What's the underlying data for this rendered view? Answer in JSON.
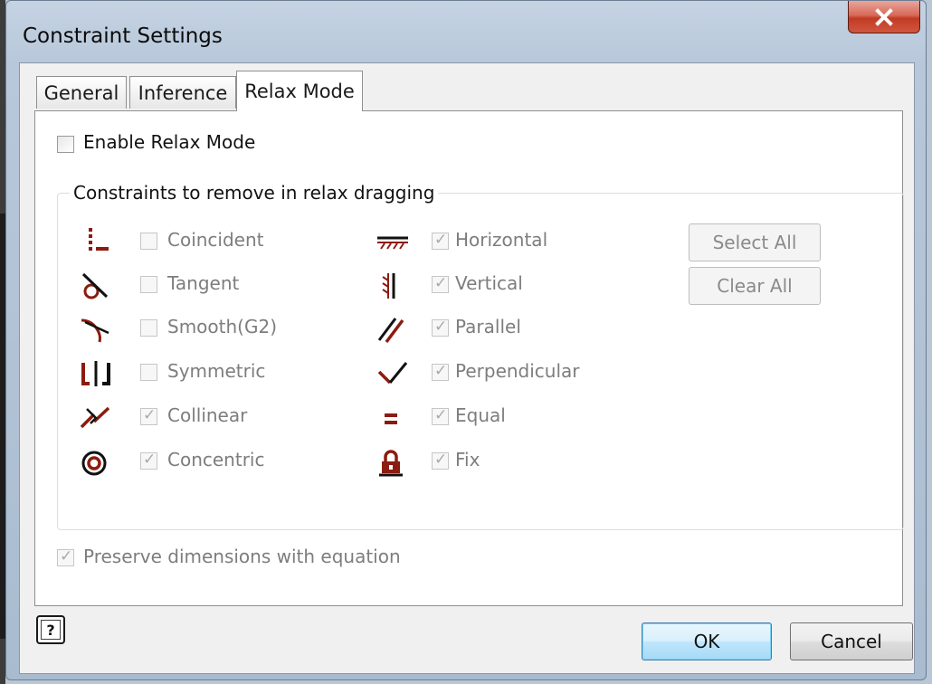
{
  "window": {
    "title": "Constraint Settings",
    "close_glyph": "x"
  },
  "tabs": [
    {
      "label": "General",
      "active": false
    },
    {
      "label": "Inference",
      "active": false
    },
    {
      "label": "Relax Mode",
      "active": true
    }
  ],
  "relax": {
    "enable_label": "Enable Relax Mode",
    "enable_checked": false,
    "group_title": "Constraints to remove in relax dragging",
    "left_column": [
      {
        "label": "Coincident",
        "icon": "coincident-icon",
        "checked": false
      },
      {
        "label": "Tangent",
        "icon": "tangent-icon",
        "checked": false
      },
      {
        "label": "Smooth(G2)",
        "icon": "smooth-icon",
        "checked": false
      },
      {
        "label": "Symmetric",
        "icon": "symmetric-icon",
        "checked": false
      },
      {
        "label": "Collinear",
        "icon": "collinear-icon",
        "checked": true
      },
      {
        "label": "Concentric",
        "icon": "concentric-icon",
        "checked": true
      }
    ],
    "right_column": [
      {
        "label": "Horizontal",
        "icon": "horizontal-icon",
        "checked": true
      },
      {
        "label": "Vertical",
        "icon": "vertical-icon",
        "checked": true
      },
      {
        "label": "Parallel",
        "icon": "parallel-icon",
        "checked": true
      },
      {
        "label": "Perpendicular",
        "icon": "perpendicular-icon",
        "checked": true
      },
      {
        "label": "Equal",
        "icon": "equal-icon",
        "checked": true
      },
      {
        "label": "Fix",
        "icon": "fix-icon",
        "checked": true
      }
    ],
    "select_all_label": "Select All",
    "clear_all_label": "Clear All",
    "preserve_label": "Preserve dimensions with equation",
    "preserve_checked": true
  },
  "footer": {
    "ok_label": "OK",
    "cancel_label": "Cancel",
    "help_glyph": "?"
  },
  "colors": {
    "icon": "#8b1c10",
    "close": "#c7432b",
    "ok_border": "#3c7fb1"
  }
}
